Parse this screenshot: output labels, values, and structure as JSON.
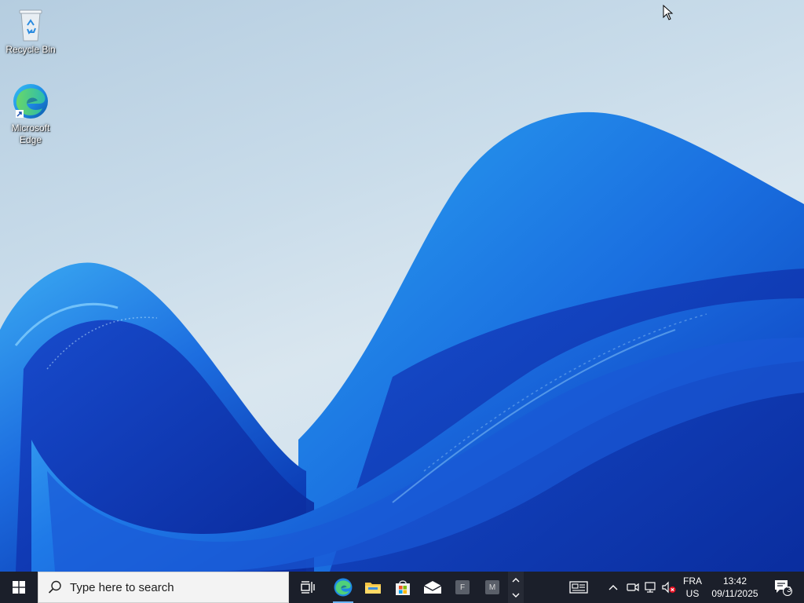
{
  "desktop": {
    "icons": [
      {
        "label": "Recycle Bin",
        "icon": "recycle-bin-icon"
      },
      {
        "label": "Microsoft Edge",
        "icon": "edge-icon"
      }
    ]
  },
  "taskbar": {
    "search_placeholder": "Type here to search",
    "pinned": [
      {
        "name": "task-view",
        "icon": "task-view-icon"
      },
      {
        "name": "edge",
        "icon": "edge-icon",
        "active": true
      },
      {
        "name": "file-explorer",
        "icon": "folder-icon"
      },
      {
        "name": "microsoft-store",
        "icon": "store-icon"
      },
      {
        "name": "mail",
        "icon": "mail-icon"
      },
      {
        "name": "app-f",
        "letter": "F"
      },
      {
        "name": "app-m",
        "letter": "M"
      }
    ],
    "tray": {
      "language_top": "FRA",
      "language_bottom": "US",
      "time": "13:42",
      "date": "09/11/2025",
      "notifications_count": "3"
    }
  },
  "colors": {
    "taskbar_bg": "#1b1f2a",
    "accent": "#0078d4",
    "search_bg": "#f3f3f3"
  }
}
